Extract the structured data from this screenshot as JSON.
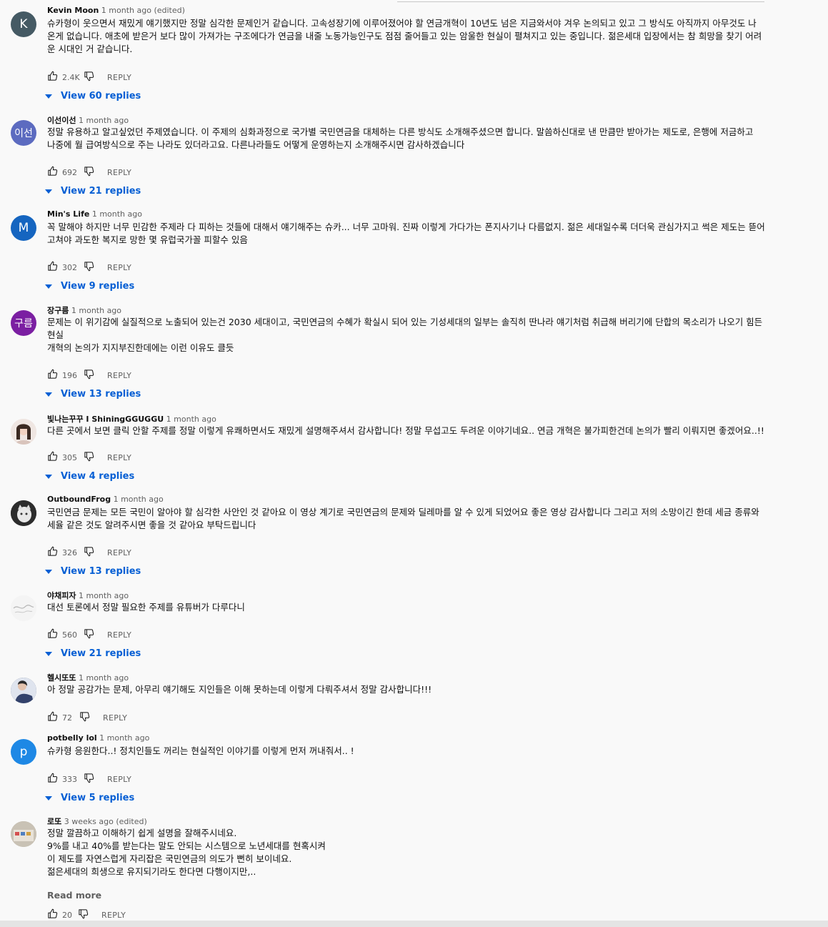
{
  "comments": [
    {
      "author": "Kevin Moon",
      "time": "1 month ago (edited)",
      "avatar_letter": "K",
      "avatar_color": "#455a64",
      "text": "슈카형이 웃으면서 재밌게 얘기했지만 정말 심각한 문제인거 같습니다. 고속성장기에 이루어졌어야 할 연금개혁이 10년도 넘은 지금와서야 겨우 논의되고 있고 그 방식도 아직까지 아무것도 나\n온게 없습니다. 애초에 받은거 보다 많이 가져가는 구조에다가 연금을 내줄 노동가능인구도 점점 줄어들고 있는 암울한 현실이 펼쳐지고 있는 중입니다. 젊은세대 입장에서는 참 희망을 찾기 어려\n운 시대인 거 같습니다.",
      "likes": "2.4K",
      "reply_label": "REPLY",
      "view_replies": "View 60 replies"
    },
    {
      "author": "이선이선",
      "time": "1 month ago",
      "avatar_letter": "이선",
      "avatar_color": "#5c6bc0",
      "text": "정말 유용하고 알고싶었던 주제였습니다. 이 주제의 심화과정으로 국가별 국민연금을 대체하는   다른 방식도 소개해주셨으면 합니다. 말씀하신대로 낸 만큼만 받아가는 제도로, 은행에 저금하고\n나중에 월 급여방식으로 주는 나라도 있더라고요. 다른나라들도 어떻게 운영하는지 소개해주시면 감사하겠습니다",
      "likes": "692",
      "reply_label": "REPLY",
      "view_replies": "View 21 replies"
    },
    {
      "author": "Min's Life",
      "time": "1 month ago",
      "avatar_letter": "M",
      "avatar_color": "#1565c0",
      "text": "꼭 말해야 하지만 너무 민감한 주제라 다 피하는 것들에 대해서 얘기해주는 슈카... 너무 고마워. 진짜 이렇게 가다가는 폰지사기나 다름없지. 젊은 세대일수록 더더욱 관심가지고 썩은 제도는 뜯어\n고쳐야 과도한 복지로 망한 몇 유럽국가꼴 피할수 있음",
      "likes": "302",
      "reply_label": "REPLY",
      "view_replies": "View 9 replies"
    },
    {
      "author": "장구름",
      "time": "1 month ago",
      "avatar_letter": "구름",
      "avatar_color": "#7b1fa2",
      "text": "문제는 이 위기감에 실질적으로 노출되어 있는건 2030 세대이고, 국민연금의 수혜가 확실시 되어 있는 기성세대의 일부는 솔직히 딴나라 얘기처럼 취급해 버리기에 단합의 목소리가 나오기 힘든\n현실\n개혁의 논의가 지지부진한데에는 이런 이유도 클듯",
      "likes": "196",
      "reply_label": "REPLY",
      "view_replies": "View 13 replies"
    },
    {
      "author": "빛나는꾸꾸 I ShiningGGUGGU",
      "time": "1 month ago",
      "avatar_letter": "",
      "avatar_color": "#e8d8d0",
      "text": "다른 곳에서 보면 클릭 안할 주제를 정말 이렇게 유쾌하면서도 재밌게 설명해주셔서 감사합니다! 정말 무섭고도 두려운 이야기네요.. 연금 개혁은 불가피한건데 논의가 빨리 이뤄지면 좋겠어요..!!",
      "likes": "305",
      "reply_label": "REPLY",
      "view_replies": "View 4 replies"
    },
    {
      "author": "OutboundFrog",
      "time": "1 month ago",
      "avatar_letter": "",
      "avatar_color": "#3a3a3a",
      "text": "국민연금 문제는 모든 국민이 알아야 할 심각한 사안인 것 같아요 이 영상 계기로 국민연금의 문제와 딜레마를 알 수 있게 되었어요 좋은 영상 감사합니다 그리고 저의 소망이긴 한데 세금 종류와\n세율 같은 것도 알려주시면 좋을 것 같아요 부탁드립니다",
      "likes": "326",
      "reply_label": "REPLY",
      "view_replies": "View 13 replies"
    },
    {
      "author": "야채피자",
      "time": "1 month ago",
      "avatar_letter": "",
      "avatar_color": "#f2f2f2",
      "text": "대선 토론에서 정말 필요한 주제를 유튜버가 다루다니",
      "likes": "560",
      "reply_label": "REPLY",
      "view_replies": "View 21 replies"
    },
    {
      "author": "헬시또또",
      "time": "1 month ago",
      "avatar_letter": "",
      "avatar_color": "#4a5a7a",
      "text": "아 정말 공감가는 문제, 아무리 얘기해도 지인들은 이해 못하는데 이렇게 다뤄주셔서 정말 감사합니다!!!",
      "likes": "72",
      "reply_label": "REPLY",
      "view_replies": ""
    },
    {
      "author": "potbelly lol",
      "time": "1 month ago",
      "avatar_letter": "p",
      "avatar_color": "#1e88e5",
      "text": "슈카형 응원한다..! 정치인들도 꺼리는 현실적인 이야기를 이렇게 먼저 꺼내줘서.. !",
      "likes": "333",
      "reply_label": "REPLY",
      "view_replies": "View 5 replies"
    },
    {
      "author": "로또",
      "time": "3 weeks ago (edited)",
      "avatar_letter": "",
      "avatar_color": "#b0a89a",
      "text": "정말 깔끔하고 이해하기 쉽게 설명을 잘해주시네요.\n9%를 내고 40%를 받는다는 말도 안되는 시스템으로 노년세대를 현혹시켜\n이 제도를 자연스럽게 자리잡은 국민연금의 의도가 뻔히 보이네요.\n젊은세대의 희생으로 유지되기라도 한다면 다행이지만,..",
      "read_more": "Read more",
      "likes": "20",
      "reply_label": "REPLY",
      "view_replies": ""
    }
  ]
}
